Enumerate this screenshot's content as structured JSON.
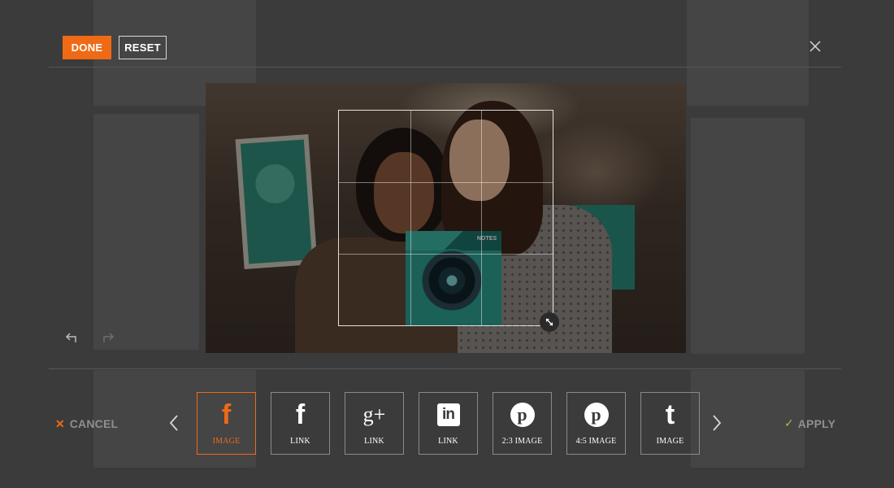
{
  "toolbar": {
    "done_label": "DONE",
    "reset_label": "RESET",
    "close_icon": "close-icon"
  },
  "editor": {
    "box_text": "NOTES",
    "undo_icon": "undo-icon",
    "redo_icon": "redo-icon",
    "resize_icon": "resize-handle-icon"
  },
  "footer": {
    "cancel_label": "CANCEL",
    "apply_label": "APPLY",
    "prev_icon": "chevron-left-icon",
    "next_icon": "chevron-right-icon"
  },
  "share_options": [
    {
      "glyph": "f",
      "icon": "facebook-icon",
      "label": "IMAGE",
      "active": true
    },
    {
      "glyph": "f",
      "icon": "facebook-icon",
      "label": "LINK",
      "active": false
    },
    {
      "glyph": "g+",
      "icon": "google-plus-icon",
      "label": "LINK",
      "active": false
    },
    {
      "glyph": "in",
      "icon": "linkedin-icon",
      "label": "LINK",
      "active": false
    },
    {
      "glyph": "p",
      "icon": "pinterest-icon",
      "label": "2:3 IMAGE",
      "active": false
    },
    {
      "glyph": "p",
      "icon": "pinterest-icon",
      "label": "4:5 IMAGE",
      "active": false
    },
    {
      "glyph": "t",
      "icon": "tumblr-icon",
      "label": "IMAGE",
      "active": false
    }
  ],
  "colors": {
    "accent": "#f06a16",
    "apply_check": "#9bc53d",
    "background": "#3b3b3c"
  }
}
